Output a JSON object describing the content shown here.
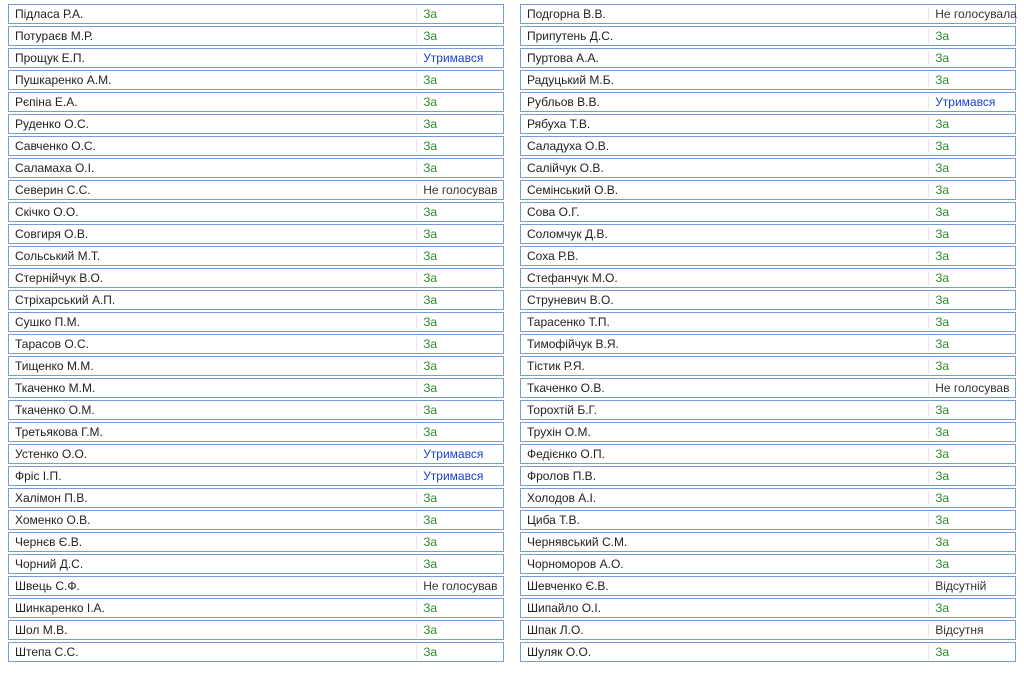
{
  "vote_labels": {
    "za": "За",
    "utry": "Утримався",
    "no_vote_m": "Не голосував",
    "no_vote_f": "Не голосувала",
    "absent_m": "Відсутній",
    "absent_f": "Відсутня"
  },
  "left": [
    {
      "name": "Підласа Р.А.",
      "vote": "za"
    },
    {
      "name": "Потураєв М.Р.",
      "vote": "za"
    },
    {
      "name": "Прощук Е.П.",
      "vote": "utry"
    },
    {
      "name": "Пушкаренко А.М.",
      "vote": "za"
    },
    {
      "name": "Рєпіна Е.А.",
      "vote": "za"
    },
    {
      "name": "Руденко О.С.",
      "vote": "za"
    },
    {
      "name": "Савченко О.С.",
      "vote": "za"
    },
    {
      "name": "Саламаха О.І.",
      "vote": "za"
    },
    {
      "name": "Северин С.С.",
      "vote": "no_vote_m"
    },
    {
      "name": "Скічко О.О.",
      "vote": "za"
    },
    {
      "name": "Совгиря О.В.",
      "vote": "za"
    },
    {
      "name": "Сольський М.Т.",
      "vote": "za"
    },
    {
      "name": "Стернійчук В.О.",
      "vote": "za"
    },
    {
      "name": "Стріхарський А.П.",
      "vote": "za"
    },
    {
      "name": "Сушко П.М.",
      "vote": "za"
    },
    {
      "name": "Тарасов О.С.",
      "vote": "za"
    },
    {
      "name": "Тищенко М.М.",
      "vote": "za"
    },
    {
      "name": "Ткаченко М.М.",
      "vote": "za"
    },
    {
      "name": "Ткаченко О.М.",
      "vote": "za"
    },
    {
      "name": "Третьякова Г.М.",
      "vote": "za"
    },
    {
      "name": "Устенко О.О.",
      "vote": "utry"
    },
    {
      "name": "Фріс І.П.",
      "vote": "utry"
    },
    {
      "name": "Халімон П.В.",
      "vote": "za"
    },
    {
      "name": "Хоменко О.В.",
      "vote": "za"
    },
    {
      "name": "Чернєв Є.В.",
      "vote": "za"
    },
    {
      "name": "Чорний Д.С.",
      "vote": "za"
    },
    {
      "name": "Швець С.Ф.",
      "vote": "no_vote_m"
    },
    {
      "name": "Шинкаренко І.А.",
      "vote": "za"
    },
    {
      "name": "Шол М.В.",
      "vote": "za"
    },
    {
      "name": "Штепа С.С.",
      "vote": "za"
    }
  ],
  "right": [
    {
      "name": "Подгорна В.В.",
      "vote": "no_vote_f"
    },
    {
      "name": "Припутень Д.С.",
      "vote": "za"
    },
    {
      "name": "Пуртова А.А.",
      "vote": "za"
    },
    {
      "name": "Радуцький М.Б.",
      "vote": "za"
    },
    {
      "name": "Рубльов В.В.",
      "vote": "utry"
    },
    {
      "name": "Рябуха Т.В.",
      "vote": "za"
    },
    {
      "name": "Саладуха О.В.",
      "vote": "za"
    },
    {
      "name": "Салійчук О.В.",
      "vote": "za"
    },
    {
      "name": "Семінський О.В.",
      "vote": "za"
    },
    {
      "name": "Сова О.Г.",
      "vote": "za"
    },
    {
      "name": "Соломчук Д.В.",
      "vote": "za"
    },
    {
      "name": "Соха Р.В.",
      "vote": "za"
    },
    {
      "name": "Стефанчук М.О.",
      "vote": "za"
    },
    {
      "name": "Струневич В.О.",
      "vote": "za"
    },
    {
      "name": "Тарасенко Т.П.",
      "vote": "za"
    },
    {
      "name": "Тимофійчук В.Я.",
      "vote": "za"
    },
    {
      "name": "Тістик Р.Я.",
      "vote": "za"
    },
    {
      "name": "Ткаченко О.В.",
      "vote": "no_vote_m"
    },
    {
      "name": "Торохтій Б.Г.",
      "vote": "za"
    },
    {
      "name": "Трухін О.М.",
      "vote": "za"
    },
    {
      "name": "Федієнко О.П.",
      "vote": "za"
    },
    {
      "name": "Фролов П.В.",
      "vote": "za"
    },
    {
      "name": "Холодов А.І.",
      "vote": "za"
    },
    {
      "name": "Циба Т.В.",
      "vote": "za"
    },
    {
      "name": "Чернявський С.М.",
      "vote": "za"
    },
    {
      "name": "Чорноморов А.О.",
      "vote": "za"
    },
    {
      "name": "Шевченко Є.В.",
      "vote": "absent_m"
    },
    {
      "name": "Шипайло О.І.",
      "vote": "za"
    },
    {
      "name": "Шпак Л.О.",
      "vote": "absent_f"
    },
    {
      "name": "Шуляк О.О.",
      "vote": "za"
    }
  ]
}
